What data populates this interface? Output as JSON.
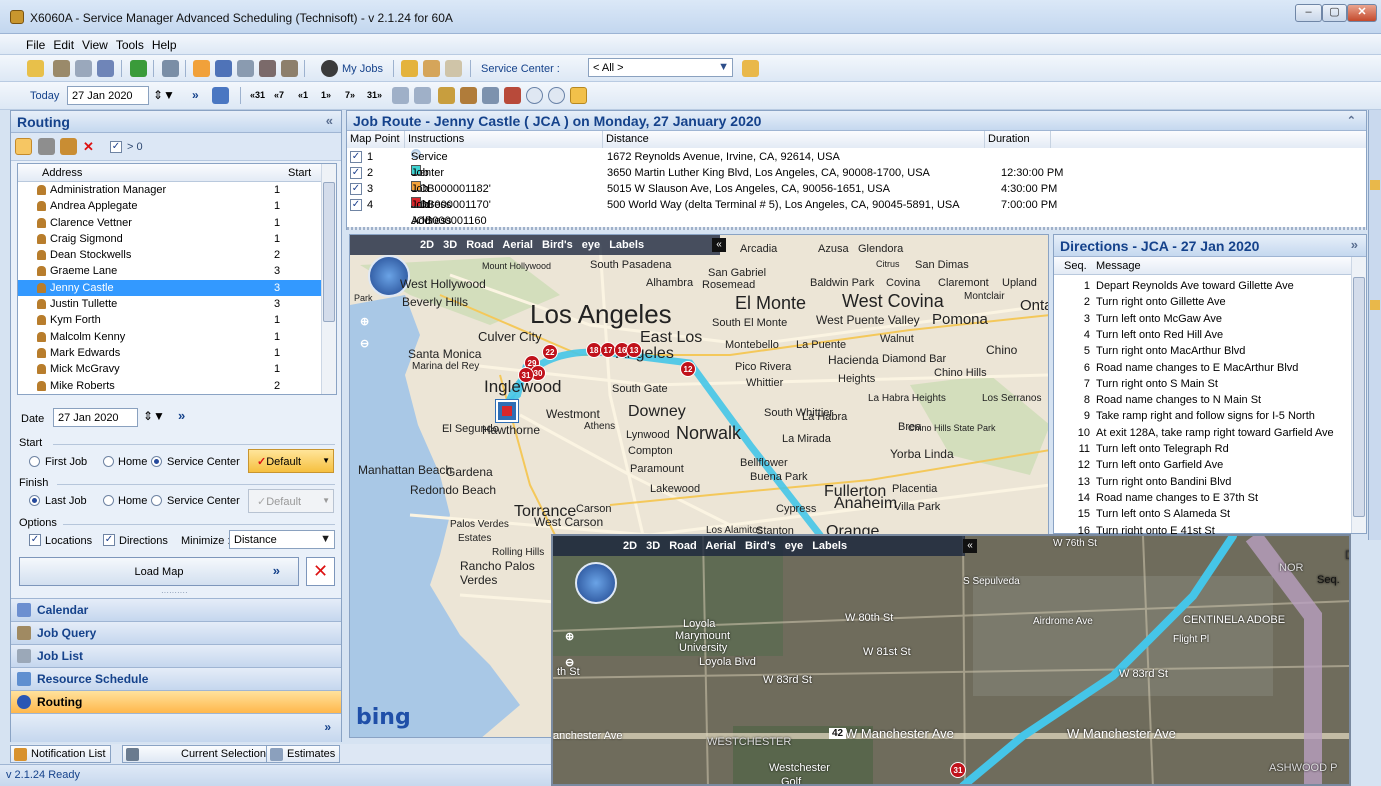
{
  "window": {
    "title": "X6060A - Service Manager Advanced Scheduling (Technisoft) - v 2.1.24  for 60A"
  },
  "menu": [
    "File",
    "Edit",
    "View",
    "Tools",
    "Help"
  ],
  "toolbar1": {
    "my_jobs": "My Jobs",
    "service_center_label": "Service Center :",
    "service_center_value": "< All >"
  },
  "toolbar2": {
    "today": "Today",
    "date": "27 Jan 2020",
    "step_labels": [
      "«31",
      "«7",
      "«1",
      "1»",
      "7»",
      "31»"
    ]
  },
  "routing": {
    "title": "Routing",
    "filter_label": "> 0",
    "columns": {
      "address": "Address",
      "start": "Start"
    },
    "resources": [
      {
        "name": "Administration Manager",
        "start": "1"
      },
      {
        "name": "Andrea Applegate",
        "start": "1"
      },
      {
        "name": "Clarence Vettner",
        "start": "1"
      },
      {
        "name": "Craig Sigmond",
        "start": "1"
      },
      {
        "name": "Dean Stockwells",
        "start": "2"
      },
      {
        "name": "Graeme Lane",
        "start": "3"
      },
      {
        "name": "Jenny Castle",
        "start": "3"
      },
      {
        "name": "Justin Tullette",
        "start": "3"
      },
      {
        "name": "Kym Forth",
        "start": "1"
      },
      {
        "name": "Malcolm Kenny",
        "start": "1"
      },
      {
        "name": "Mark Edwards",
        "start": "1"
      },
      {
        "name": "Mick McGravy",
        "start": "1"
      },
      {
        "name": "Mike Roberts",
        "start": "2"
      }
    ],
    "selected_index": 6,
    "date_label": "Date",
    "date_value": "27 Jan 2020",
    "start_group": "Start",
    "finish_group": "Finish",
    "options_group": "Options",
    "start_options": {
      "first": "First Job",
      "home": "Home",
      "service": "Service Center",
      "default": "Default"
    },
    "finish_options": {
      "last": "Last Job",
      "home": "Home",
      "service": "Service Center",
      "default": "Default"
    },
    "opt_locations": "Locations",
    "opt_directions": "Directions",
    "minimize_label": "Minimize :",
    "minimize_value": "Distance",
    "load_map": "Load Map"
  },
  "nav": [
    "Calendar",
    "Job Query",
    "Job List",
    "Resource Schedule",
    "Routing"
  ],
  "route": {
    "title": "Job Route - Jenny Castle ( JCA ) on Monday, 27 January 2020",
    "columns": {
      "map_point": "Map Point",
      "instructions": "Instructions",
      "distance": "Distance",
      "duration": "Duration"
    },
    "rows": [
      {
        "point": "1",
        "instruction": "Service Center 3",
        "distance": "1672 Reynolds Avenue, Irvine, CA, 92614, USA",
        "duration": "",
        "color": "#7aa7d6"
      },
      {
        "point": "2",
        "instruction": "Job 'JOB000001182' Address",
        "distance": "3650 Martin Luther King Blvd, Los Angeles, CA, 90008-1700, USA",
        "duration": "12:30:00 PM",
        "color": "#3fd3d1"
      },
      {
        "point": "3",
        "instruction": "Job 'JOB000001170' Address",
        "distance": "5015 W Slauson Ave, Los Angeles, CA, 90056-1651, USA",
        "duration": "4:30:00 PM",
        "color": "#f3a23a"
      },
      {
        "point": "4",
        "instruction": "Job JOB000001160",
        "distance": "500 World Way (delta Terminal # 5), Los Angeles, CA, 90045-5891, USA",
        "duration": "7:00:00 PM",
        "color": "#d8262b"
      }
    ]
  },
  "directions": {
    "title": "Directions - JCA - 27 Jan 2020",
    "columns": {
      "seq": "Seq.",
      "message": "Message"
    },
    "items": [
      {
        "seq": "1",
        "msg": "Depart Reynolds Ave toward Gillette Ave"
      },
      {
        "seq": "2",
        "msg": "Turn right onto Gillette Ave"
      },
      {
        "seq": "3",
        "msg": "Turn left onto McGaw Ave"
      },
      {
        "seq": "4",
        "msg": "Turn left onto Red Hill Ave"
      },
      {
        "seq": "5",
        "msg": "Turn right onto MacArthur Blvd"
      },
      {
        "seq": "6",
        "msg": "Road name changes to E MacArthur Blvd"
      },
      {
        "seq": "7",
        "msg": "Turn right onto S Main St"
      },
      {
        "seq": "8",
        "msg": "Road name changes to N Main St"
      },
      {
        "seq": "9",
        "msg": "Take ramp right and follow signs for I-5 North"
      },
      {
        "seq": "10",
        "msg": "At exit 128A, take ramp right toward Garfield Ave"
      },
      {
        "seq": "11",
        "msg": "Turn left onto Telegraph Rd"
      },
      {
        "seq": "12",
        "msg": "Turn left onto Garfield Ave"
      },
      {
        "seq": "13",
        "msg": "Turn right onto Bandini Blvd"
      },
      {
        "seq": "14",
        "msg": "Road name changes to E 37th St"
      },
      {
        "seq": "15",
        "msg": "Turn left onto S Alameda St"
      },
      {
        "seq": "16",
        "msg": "Turn right onto E 41st St"
      }
    ]
  },
  "map": {
    "modes": "2D  3D  Road  Aerial  Bird's eye  Labels",
    "brand": "bing",
    "places": [
      "Arcadia",
      "Azusa",
      "Glendora",
      "Mount Hollywood",
      "South Pasadena",
      "San Gabriel",
      "Citrus",
      "San Dimas",
      "West Hollywood",
      "Alhambra",
      "Rosemead",
      "Baldwin Park",
      "Covina",
      "Claremont",
      "Upland",
      "Beverly Hills",
      "El Monte",
      "West Covina",
      "Montclair",
      "Ontar",
      "Los Angeles",
      "South El Monte",
      "West Puente Valley",
      "Pomona",
      "Culver City",
      "East Los",
      "Montebello",
      "La Puente",
      "Walnut",
      "Chino",
      "Santa Monica",
      "Angeles",
      "Hacienda",
      "Diamond Bar",
      "Marina del Rey",
      "Pico Rivera",
      "Whittier",
      "Heights",
      "Chino Hills",
      "Inglewood",
      "South Gate",
      "La Habra Heights",
      "Los Serranos",
      "Westmont",
      "Downey",
      "South Whittier",
      "La Habra",
      "El Segundo",
      "Hawthorne",
      "Athens",
      "Lynwood",
      "Norwalk",
      "La Mirada",
      "Brea",
      "Compton",
      "Bellflower",
      "Yorba Linda",
      "Manhattan Beach",
      "Gardena",
      "Paramount",
      "Fullerton",
      "Placentia",
      "Buena Park",
      "Redondo Beach",
      "Lakewood",
      "Torrance",
      "Carson",
      "Cypress",
      "Anaheim",
      "Villa Park",
      "Palos Verdes",
      "Estates",
      "West Carson",
      "Signal Hill",
      "Los Alamitos",
      "Stanton",
      "Orange",
      "Rolling Hills",
      "Rancho Palos",
      "Verdes",
      "Park",
      "Chino Hills State Park"
    ],
    "pins": [
      "22",
      "18",
      "17",
      "16",
      "13",
      "12",
      "29",
      "30",
      "31"
    ]
  },
  "inset_map": {
    "modes": "2D  3D  Road  Aerial  Bird's eye  Labels",
    "places": [
      "Loyola",
      "Marymount",
      "University",
      "W 80th St",
      "W 81st St",
      "W 83rd St",
      "W 83rd St",
      "W Manchester Ave",
      "W Manchester Ave",
      "anchester Ave",
      "WESTCHESTER",
      "Westchester",
      "Golf",
      "CENTINELA ADOBE",
      "ASHWOOD P",
      "Loyola Blvd",
      "Flight Pl",
      "Airdrome Ave",
      "S Sepulveda",
      "W 76th St",
      "Seq.",
      "Dire",
      "NOR",
      "th St"
    ],
    "road_badge": "42",
    "pin": "31"
  },
  "bottom_tabs": [
    "Notification List",
    "Current Selection",
    "Estimates"
  ],
  "status": "v 2.1.24   Ready",
  "colors": {
    "accent_blue": "#15428b",
    "selection": "#3399ff",
    "route": "#45c5e8",
    "pin": "#c0121b",
    "nav_active": "#ffb74c"
  }
}
